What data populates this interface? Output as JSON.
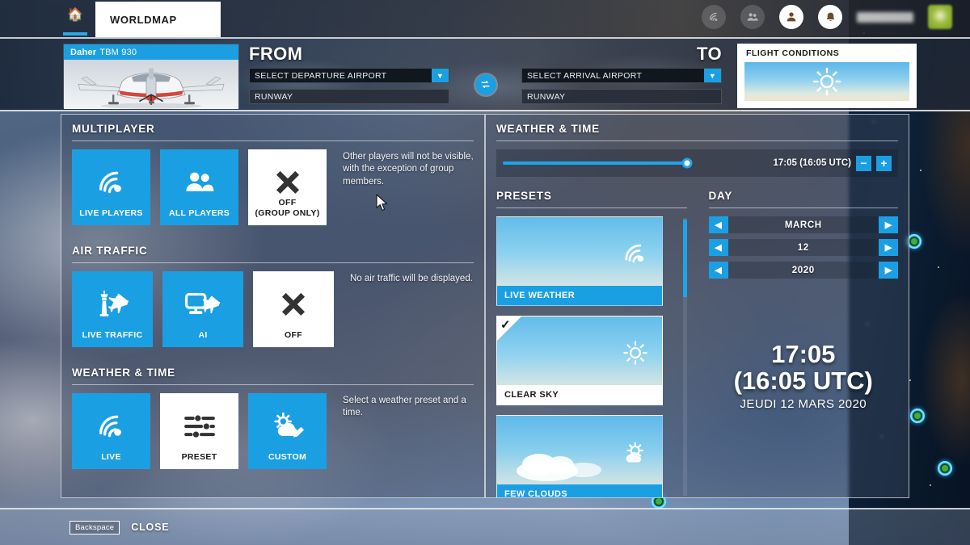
{
  "topnav": {
    "home_icon": "home-icon",
    "active_tab": "WORLDMAP",
    "icons": [
      {
        "name": "live-radar-icon",
        "glyph": "◎"
      },
      {
        "name": "friends-group-icon",
        "glyph": "●"
      },
      {
        "name": "profile-icon",
        "glyph": "●"
      },
      {
        "name": "notifications-bell-icon",
        "glyph": "●"
      }
    ]
  },
  "header": {
    "aircraft": {
      "brand": "Daher",
      "model": "TBM 930"
    },
    "from_label": "FROM",
    "to_label": "TO",
    "departure_value": "SELECT DEPARTURE AIRPORT",
    "arrival_value": "SELECT ARRIVAL AIRPORT",
    "departure_runway": "RUNWAY",
    "arrival_runway": "RUNWAY",
    "swap_icon": "swap-arrows-icon",
    "flight_conditions_title": "FLIGHT CONDITIONS",
    "flight_conditions_icon": "sun-icon"
  },
  "left_panel": {
    "multiplayer": {
      "title": "MULTIPLAYER",
      "description": "Other players will not be visible, with the exception of group members.",
      "options": [
        {
          "label": "LIVE PLAYERS",
          "icon": "live-signal-icon",
          "selected": false
        },
        {
          "label": "ALL PLAYERS",
          "icon": "two-people-icon",
          "selected": false
        },
        {
          "label": "OFF\n(GROUP ONLY)",
          "icon": "cross-icon",
          "selected": true
        }
      ]
    },
    "air_traffic": {
      "title": "AIR TRAFFIC",
      "description": "No air traffic will be displayed.",
      "options": [
        {
          "label": "LIVE TRAFFIC",
          "icon": "control-tower-plane-icon",
          "selected": false
        },
        {
          "label": "AI",
          "icon": "monitor-plane-icon",
          "selected": false
        },
        {
          "label": "OFF",
          "icon": "cross-icon",
          "selected": true
        }
      ]
    },
    "weather_time": {
      "title": "WEATHER & TIME",
      "description": "Select a weather preset and a time.",
      "options": [
        {
          "label": "LIVE",
          "icon": "live-signal-icon",
          "selected": false
        },
        {
          "label": "PRESET",
          "icon": "sliders-icon",
          "selected": true
        },
        {
          "label": "CUSTOM",
          "icon": "sun-cloud-edit-icon",
          "selected": false
        }
      ]
    }
  },
  "right_panel": {
    "title": "WEATHER & TIME",
    "time_slider": {
      "value_percent": 71,
      "time_text": "17:05 (16:05 UTC)",
      "minus_label": "−",
      "plus_label": "+"
    },
    "presets": {
      "title": "PRESETS",
      "scroll_percent": 0,
      "items": [
        {
          "label": "LIVE WEATHER",
          "icon": "live-signal-icon",
          "selected": false
        },
        {
          "label": "CLEAR SKY",
          "icon": "sun-icon",
          "selected": true
        },
        {
          "label": "FEW CLOUDS",
          "icon": "sun-behind-cloud-icon",
          "selected": false
        }
      ]
    },
    "day": {
      "title": "DAY",
      "rows": [
        {
          "name": "month",
          "value": "MARCH"
        },
        {
          "name": "day",
          "value": "12"
        },
        {
          "name": "year",
          "value": "2020"
        }
      ],
      "prev_icon": "chevron-left-icon",
      "next_icon": "chevron-right-icon"
    },
    "clock": {
      "time": "17:05",
      "utc": "(16:05 UTC)",
      "date": "JEUDI 12 MARS 2020"
    }
  },
  "bottombar": {
    "key": "Backspace",
    "action": "CLOSE"
  }
}
